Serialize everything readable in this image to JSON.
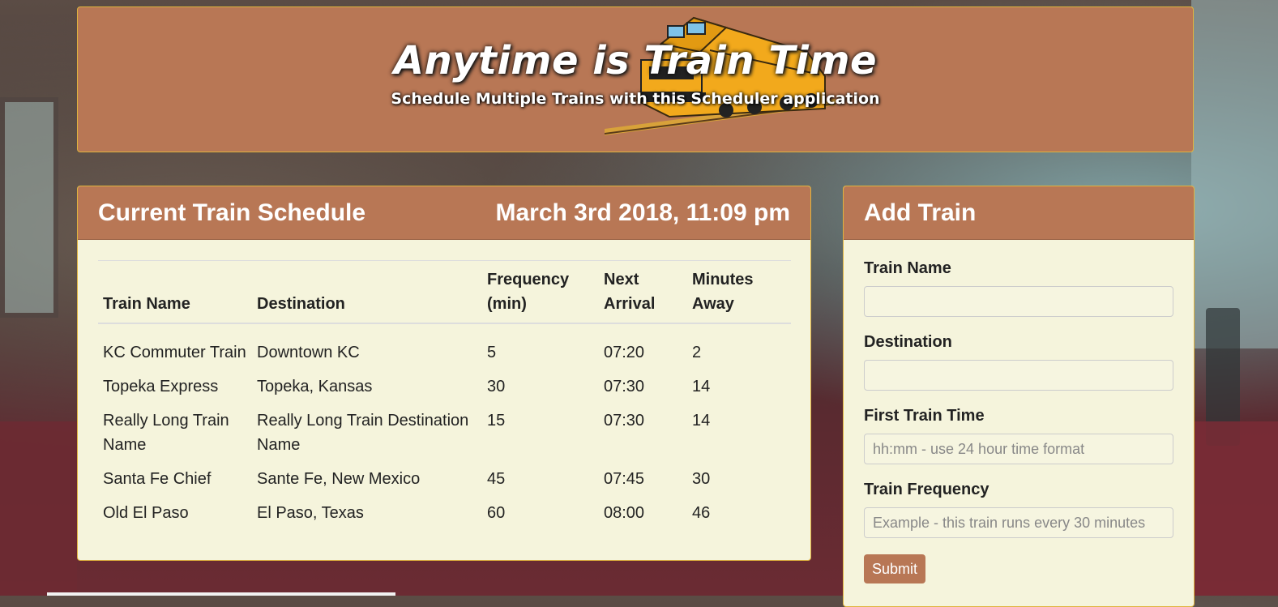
{
  "jumbotron": {
    "title": "Anytime is Train Time",
    "subtitle": "Schedule Multiple Trains with this Scheduler application"
  },
  "schedule_panel": {
    "title": "Current Train Schedule",
    "datetime": "March 3rd 2018, 11:09 pm",
    "headers": [
      "Train Name",
      "Destination",
      "Frequency (min)",
      "Next Arrival",
      "Minutes Away"
    ],
    "rows": [
      [
        "KC Commuter Train",
        "Downtown KC",
        "5",
        "07:20",
        "2"
      ],
      [
        "Topeka Express",
        "Topeka, Kansas",
        "30",
        "07:30",
        "14"
      ],
      [
        "Really Long Train Name",
        "Really Long Train Destination Name",
        "15",
        "07:30",
        "14"
      ],
      [
        "Santa Fe Chief",
        "Sante Fe, New Mexico",
        "45",
        "07:45",
        "30"
      ],
      [
        "Old El Paso",
        "El Paso, Texas",
        "60",
        "08:00",
        "46"
      ]
    ]
  },
  "add_panel": {
    "title": "Add Train",
    "fields": [
      {
        "label": "Train Name",
        "value": "",
        "placeholder": ""
      },
      {
        "label": "Destination",
        "value": "",
        "placeholder": ""
      },
      {
        "label": "First Train Time",
        "value": "",
        "placeholder": "hh:mm - use 24 hour time format"
      },
      {
        "label": "Train Frequency",
        "value": "",
        "placeholder": "Example - this train runs every 30 minutes"
      }
    ],
    "submit_label": "Submit"
  },
  "colors": {
    "panel_heading": "#b87755",
    "panel_body": "#f5f4dc",
    "panel_border": "#e0b43e",
    "locomotive_yellow": "#f2a91c"
  },
  "icons": {
    "header_image": "locomotive-icon"
  }
}
